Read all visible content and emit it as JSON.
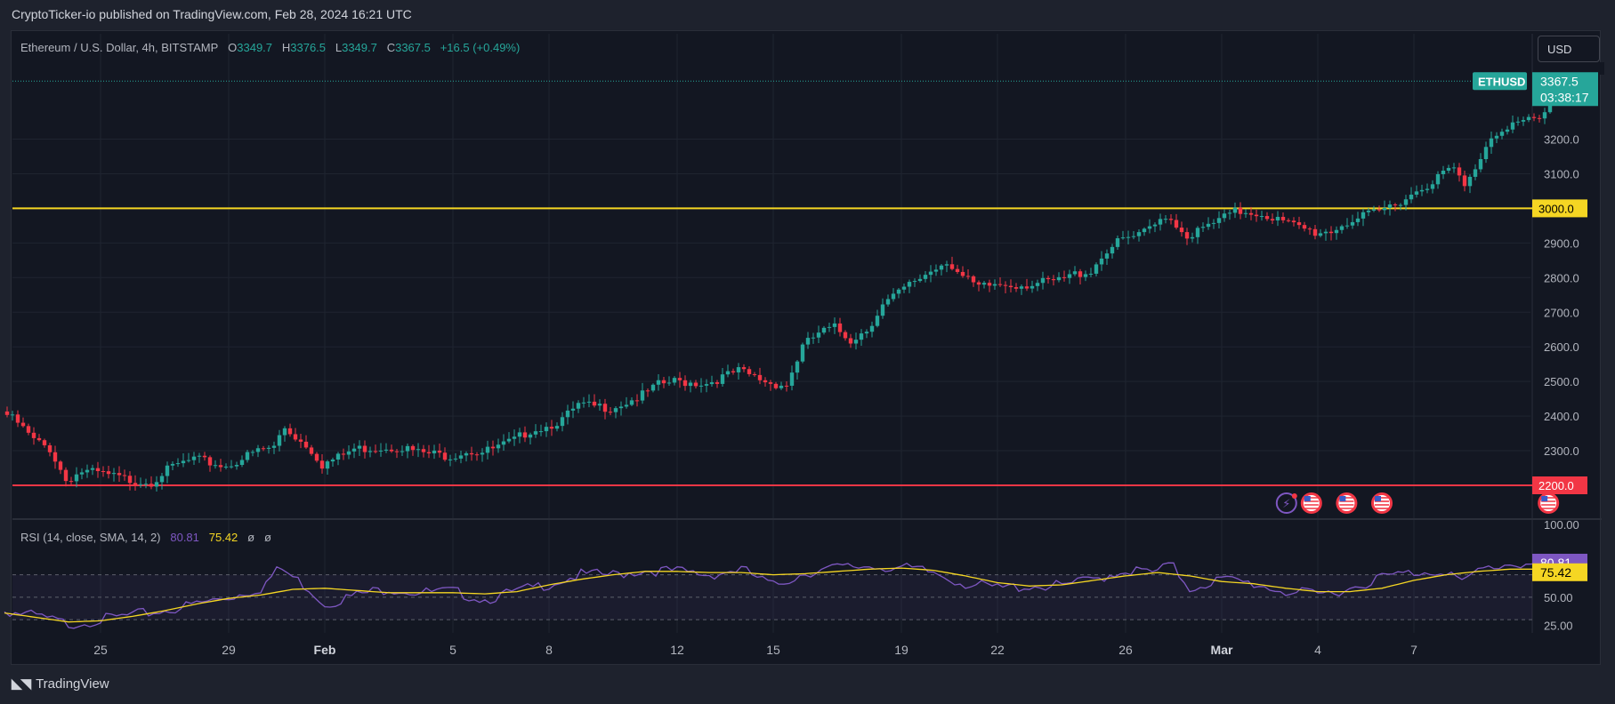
{
  "publish_line": "CryptoTicker-io published on TradingView.com, Feb 28, 2024 16:21 UTC",
  "footer_brand": "TradingView",
  "currency_button": "USD",
  "legend": {
    "symbol": "Ethereum / U.S. Dollar, 4h, BITSTAMP",
    "o_label": "O",
    "o": "3349.7",
    "h_label": "H",
    "h": "3376.5",
    "l_label": "L",
    "l": "3349.7",
    "c_label": "C",
    "c": "3367.5",
    "change": "+16.5 (+0.49%)"
  },
  "rsi_legend": {
    "name": "RSI (14, close, SMA, 14, 2)",
    "rsi": "80.81",
    "sma": "75.42",
    "extra1": "ø",
    "extra2": "ø"
  },
  "colors": {
    "up": "#26a69a",
    "down": "#f23645",
    "support": "#f23645",
    "resistance": "#f5d623",
    "rsi": "#7e57c2",
    "rsi_ma": "#f5d623",
    "bg": "#131722",
    "grid": "#1f2430",
    "text": "#b2b5be"
  },
  "icons": [
    "lightning-icon",
    "us-flag-icon",
    "us-flag-icon",
    "us-flag-icon"
  ],
  "chart_data": [
    {
      "type": "candlestick",
      "symbol": "ETHUSD",
      "interval": "4h",
      "ylim": [
        2150,
        3420
      ],
      "y_ticks": [
        "3200.0",
        "3100.0",
        "3000.0",
        "2900.0",
        "2800.0",
        "2700.0",
        "2600.0",
        "2500.0",
        "2400.0",
        "2300.0",
        "2200.0"
      ],
      "x_ticks": [
        "25",
        "29",
        "Feb",
        "5",
        "8",
        "12",
        "15",
        "19",
        "22",
        "26",
        "Mar",
        "4",
        "7"
      ],
      "x_tick_days": [
        2,
        6,
        9,
        13,
        16,
        20,
        23,
        27,
        30,
        34,
        37,
        40,
        43
      ],
      "start_day": -1.0,
      "bar_hours": 4,
      "anchors": [
        [
          -1.0,
          2415
        ],
        [
          -0.5,
          2380
        ],
        [
          0.0,
          2330
        ],
        [
          0.5,
          2305
        ],
        [
          1.0,
          2215
        ],
        [
          1.5,
          2240
        ],
        [
          2.0,
          2235
        ],
        [
          3.0,
          2215
        ],
        [
          3.7,
          2210
        ],
        [
          4.0,
          2235
        ],
        [
          4.5,
          2260
        ],
        [
          5.0,
          2275
        ],
        [
          6.0,
          2255
        ],
        [
          7.0,
          2300
        ],
        [
          7.5,
          2310
        ],
        [
          7.8,
          2370
        ],
        [
          8.3,
          2330
        ],
        [
          8.6,
          2310
        ],
        [
          9.0,
          2260
        ],
        [
          9.5,
          2280
        ],
        [
          10.0,
          2305
        ],
        [
          11.0,
          2310
        ],
        [
          11.5,
          2310
        ],
        [
          12.0,
          2295
        ],
        [
          13.0,
          2285
        ],
        [
          13.5,
          2300
        ],
        [
          14.0,
          2295
        ],
        [
          14.5,
          2310
        ],
        [
          15.0,
          2330
        ],
        [
          15.5,
          2360
        ],
        [
          16.0,
          2370
        ],
        [
          16.5,
          2390
        ],
        [
          17.0,
          2430
        ],
        [
          18.0,
          2425
        ],
        [
          18.5,
          2440
        ],
        [
          19.0,
          2460
        ],
        [
          19.5,
          2490
        ],
        [
          20.0,
          2500
        ],
        [
          21.0,
          2495
        ],
        [
          22.0,
          2530
        ],
        [
          23.0,
          2495
        ],
        [
          23.5,
          2490
        ],
        [
          24.0,
          2600
        ],
        [
          24.5,
          2640
        ],
        [
          25.0,
          2655
        ],
        [
          25.5,
          2620
        ],
        [
          26.0,
          2650
        ],
        [
          26.5,
          2720
        ],
        [
          27.0,
          2755
        ],
        [
          27.5,
          2790
        ],
        [
          28.0,
          2820
        ],
        [
          28.5,
          2850
        ],
        [
          29.0,
          2800
        ],
        [
          29.5,
          2770
        ],
        [
          30.0,
          2780
        ],
        [
          31.0,
          2780
        ],
        [
          32.0,
          2790
        ],
        [
          32.5,
          2810
        ],
        [
          33.0,
          2820
        ],
        [
          33.5,
          2880
        ],
        [
          34.0,
          2910
        ],
        [
          34.5,
          2920
        ],
        [
          35.0,
          2950
        ],
        [
          35.3,
          2985
        ],
        [
          35.6,
          2960
        ],
        [
          36.0,
          2920
        ],
        [
          36.5,
          2940
        ],
        [
          37.0,
          2965
        ],
        [
          37.5,
          2990
        ],
        [
          38.0,
          2990
        ],
        [
          38.5,
          2980
        ],
        [
          39.0,
          2960
        ],
        [
          39.5,
          2945
        ],
        [
          40.0,
          2930
        ],
        [
          40.5,
          2935
        ],
        [
          41.0,
          2960
        ],
        [
          41.5,
          2975
        ],
        [
          42.0,
          2990
        ],
        [
          42.5,
          3015
        ],
        [
          43.0,
          3040
        ],
        [
          43.5,
          3070
        ],
        [
          44.0,
          3100
        ],
        [
          44.3,
          3120
        ],
        [
          44.7,
          3055
        ],
        [
          45.0,
          3120
        ],
        [
          45.5,
          3210
        ],
        [
          46.0,
          3240
        ],
        [
          46.5,
          3250
        ],
        [
          47.0,
          3255
        ],
        [
          47.3,
          3290
        ],
        [
          47.6,
          3350
        ],
        [
          47.85,
          3367.5
        ]
      ],
      "horizontal_levels": [
        {
          "value": 3000.0,
          "label": "3000.0",
          "color": "#f5d623"
        },
        {
          "value": 2200.0,
          "label": "2200.0",
          "color": "#f23645"
        }
      ],
      "last_price": {
        "symbol": "ETHUSD",
        "price": "3367.5",
        "countdown": "03:38:17",
        "value": 3367.5
      },
      "events_day": [
        39.8,
        40.9,
        42.0,
        47.2
      ]
    },
    {
      "type": "line",
      "name": "RSI",
      "ylim": [
        20,
        110
      ],
      "y_ticks": [
        "100.00",
        "50.00",
        "25.00"
      ],
      "bands": [
        30,
        50,
        70
      ],
      "last_rsi": {
        "value": 80.81,
        "label": "80.81"
      },
      "last_ma": {
        "value": 75.42,
        "label": "75.42"
      },
      "anchors": [
        [
          -1.0,
          38
        ],
        [
          0.0,
          33
        ],
        [
          1.0,
          26
        ],
        [
          2.0,
          30
        ],
        [
          3.0,
          34
        ],
        [
          4.0,
          38
        ],
        [
          5.0,
          44
        ],
        [
          6.0,
          50
        ],
        [
          7.0,
          58
        ],
        [
          7.6,
          76
        ],
        [
          8.5,
          58
        ],
        [
          9.0,
          44
        ],
        [
          10.0,
          52
        ],
        [
          11.0,
          58
        ],
        [
          12.0,
          54
        ],
        [
          13.0,
          55
        ],
        [
          14.0,
          48
        ],
        [
          15.0,
          55
        ],
        [
          16.0,
          62
        ],
        [
          17.0,
          70
        ],
        [
          18.0,
          70
        ],
        [
          19.0,
          74
        ],
        [
          20.0,
          73
        ],
        [
          21.0,
          70
        ],
        [
          22.0,
          75
        ],
        [
          23.0,
          60
        ],
        [
          24.0,
          72
        ],
        [
          25.0,
          76
        ],
        [
          26.0,
          78
        ],
        [
          27.0,
          76
        ],
        [
          28.0,
          72
        ],
        [
          29.0,
          62
        ],
        [
          30.0,
          58
        ],
        [
          31.0,
          60
        ],
        [
          32.0,
          60
        ],
        [
          33.0,
          66
        ],
        [
          34.0,
          74
        ],
        [
          35.0,
          72
        ],
        [
          35.4,
          80
        ],
        [
          36.0,
          58
        ],
        [
          37.0,
          66
        ],
        [
          38.0,
          62
        ],
        [
          39.0,
          55
        ],
        [
          40.0,
          52
        ],
        [
          41.0,
          58
        ],
        [
          42.0,
          68
        ],
        [
          43.0,
          72
        ],
        [
          44.0,
          74
        ],
        [
          44.6,
          62
        ],
        [
          45.0,
          74
        ],
        [
          46.0,
          80
        ],
        [
          47.0,
          79
        ],
        [
          47.85,
          80.81
        ]
      ],
      "ma_anchors": [
        [
          -1.0,
          36
        ],
        [
          0.0,
          32
        ],
        [
          1.0,
          28
        ],
        [
          2.0,
          29
        ],
        [
          3.0,
          33
        ],
        [
          4.0,
          38
        ],
        [
          5.0,
          44
        ],
        [
          6.0,
          49
        ],
        [
          7.0,
          52
        ],
        [
          8.0,
          57
        ],
        [
          9.0,
          58
        ],
        [
          10.0,
          56
        ],
        [
          11.0,
          54
        ],
        [
          12.0,
          54
        ],
        [
          13.0,
          54
        ],
        [
          14.0,
          53
        ],
        [
          15.0,
          55
        ],
        [
          16.0,
          61
        ],
        [
          17.0,
          66
        ],
        [
          18.0,
          70
        ],
        [
          19.0,
          73
        ],
        [
          20.0,
          73
        ],
        [
          21.0,
          72
        ],
        [
          22.0,
          72
        ],
        [
          23.0,
          70
        ],
        [
          24.0,
          71
        ],
        [
          25.0,
          73
        ],
        [
          26.0,
          75
        ],
        [
          27.0,
          76
        ],
        [
          28.0,
          74
        ],
        [
          29.0,
          69
        ],
        [
          30.0,
          63
        ],
        [
          31.0,
          60
        ],
        [
          32.0,
          61
        ],
        [
          33.0,
          65
        ],
        [
          34.0,
          69
        ],
        [
          35.0,
          72
        ],
        [
          36.0,
          69
        ],
        [
          37.0,
          64
        ],
        [
          38.0,
          62
        ],
        [
          39.0,
          58
        ],
        [
          40.0,
          55
        ],
        [
          41.0,
          55
        ],
        [
          42.0,
          58
        ],
        [
          43.0,
          65
        ],
        [
          44.0,
          70
        ],
        [
          45.0,
          73
        ],
        [
          46.0,
          75
        ],
        [
          47.0,
          75
        ],
        [
          47.85,
          75.42
        ]
      ]
    }
  ]
}
